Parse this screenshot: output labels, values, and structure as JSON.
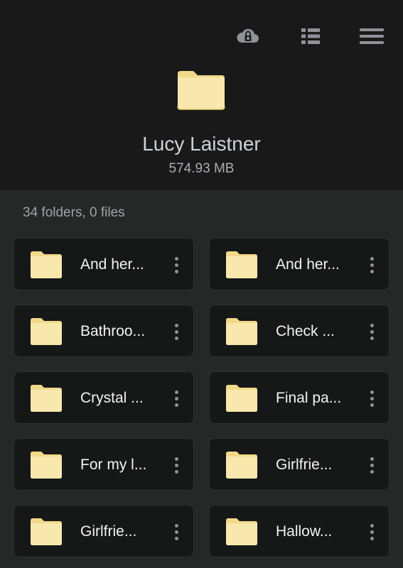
{
  "header": {
    "owner_name": "Lucy Laistner",
    "size": "574.93 MB",
    "toolbar": {
      "cloud_icon": "cloud-lock-icon",
      "list_view_icon": "list-view-icon",
      "menu_icon": "hamburger-menu-icon"
    }
  },
  "summary": "34 folders, 0 files",
  "folders": [
    {
      "name": "And her...",
      "icon": "folder-icon"
    },
    {
      "name": "And her...",
      "icon": "folder-icon"
    },
    {
      "name": "Bathroo...",
      "icon": "folder-icon"
    },
    {
      "name": "Check ...",
      "icon": "folder-icon"
    },
    {
      "name": "Crystal ...",
      "icon": "folder-icon"
    },
    {
      "name": "Final pa...",
      "icon": "folder-icon"
    },
    {
      "name": "For my l...",
      "icon": "folder-icon"
    },
    {
      "name": "Girlfrie...",
      "icon": "folder-icon"
    },
    {
      "name": "Girlfrie...",
      "icon": "folder-icon"
    },
    {
      "name": "Hallow...",
      "icon": "folder-icon"
    }
  ],
  "colors": {
    "header_bg": "#191919",
    "body_bg": "#262727",
    "card_bg": "#161717",
    "folder_fill": "#f7e6a9",
    "folder_tab": "#f2d98a",
    "icon_gray": "#8f9398"
  }
}
